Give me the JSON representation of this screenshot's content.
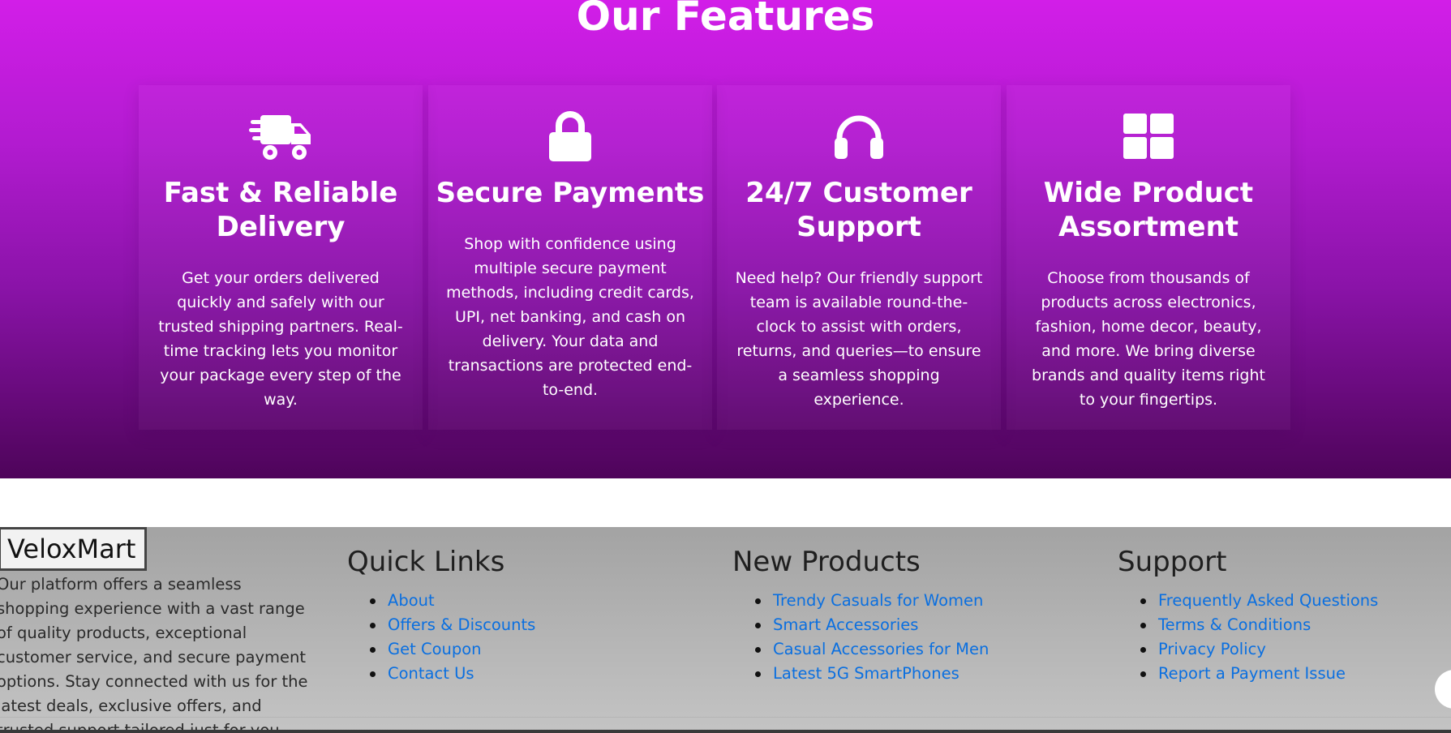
{
  "features": {
    "title": "Our Features",
    "cards": [
      {
        "icon": "truck-fast-icon",
        "title": "Fast & Reliable Delivery",
        "description": "Get your orders delivered quickly and safely with our trusted shipping partners. Real-time tracking lets you monitor your package every step of the way."
      },
      {
        "icon": "lock-icon",
        "title": "Secure Payments",
        "description": "Shop with confidence using multiple secure payment methods, including credit cards, UPI, net banking, and cash on delivery. Your data and transactions are protected end-to-end."
      },
      {
        "icon": "headphones-icon",
        "title": "24/7 Customer Support",
        "description": "Need help? Our friendly support team is available round-the-clock to assist with orders, returns, and queries—to ensure a seamless shopping experience."
      },
      {
        "icon": "grid-icon",
        "title": "Wide Product Assortment",
        "description": "Choose from thousands of products across electronics, fashion, home decor, beauty, and more. We bring diverse brands and quality items right to your fingertips."
      }
    ],
    "colors": {
      "gradient_top": "#d21ee8",
      "gradient_bottom": "#4e045a"
    }
  },
  "footer": {
    "brand": "VeloxMart",
    "about": "Our platform offers a seamless shopping experience with a vast range of quality products, exceptional customer service, and secure payment options. Stay connected with us for the latest deals, exclusive offers, and trusted support tailored just for you",
    "quick_links": {
      "heading": "Quick Links",
      "items": [
        "About",
        "Offers & Discounts",
        "Get Coupon",
        "Contact Us"
      ]
    },
    "new_products": {
      "heading": "New Products",
      "items": [
        "Trendy Casuals for Women",
        "Smart Accessories",
        "Casual Accessories for Men",
        "Latest 5G SmartPhones"
      ]
    },
    "support": {
      "heading": "Support",
      "items": [
        "Frequently Asked Questions",
        "Terms & Conditions",
        "Privacy Policy",
        "Report a Payment Issue"
      ]
    },
    "colors": {
      "link": "#0a6fe0",
      "background": "#a3a3a3"
    }
  }
}
